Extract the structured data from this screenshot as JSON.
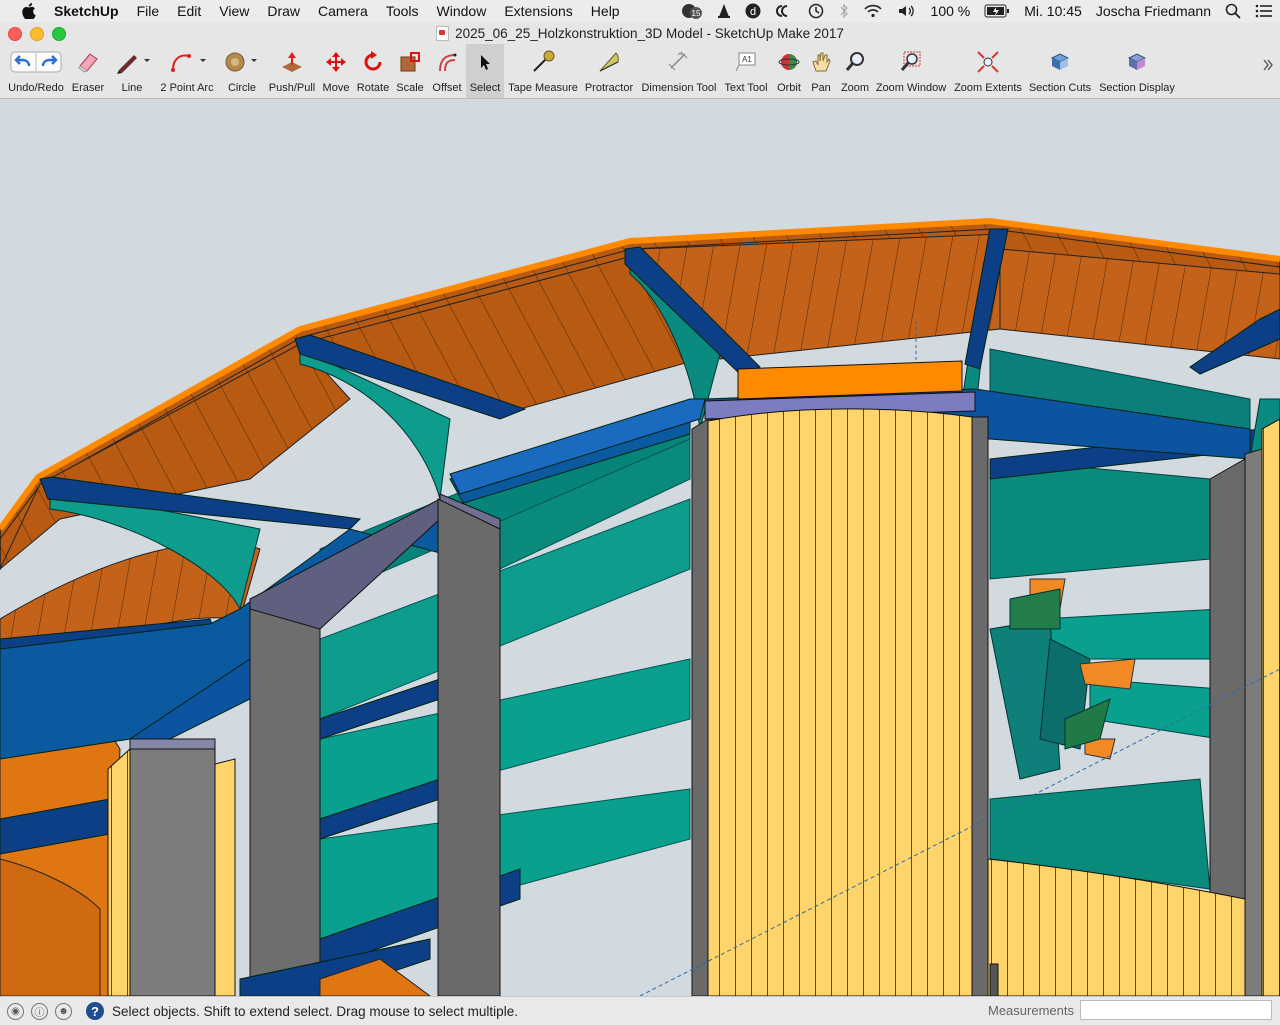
{
  "menubar": {
    "app_name": "SketchUp",
    "items": [
      "File",
      "Edit",
      "View",
      "Draw",
      "Camera",
      "Tools",
      "Window",
      "Extensions",
      "Help"
    ],
    "battery": "100 %",
    "clock": "Mi. 10:45",
    "user": "Joscha Friedmann",
    "badge_count": "15"
  },
  "window": {
    "title": "2025_06_25_Holzkonstruktion_3D Model - SketchUp Make 2017"
  },
  "toolbar": {
    "tools": [
      {
        "label": "Undo/Redo",
        "icon": "undo-redo-icon"
      },
      {
        "label": "Eraser",
        "icon": "eraser-icon"
      },
      {
        "label": "Line",
        "icon": "pencil-icon"
      },
      {
        "label": "2 Point Arc",
        "icon": "arc-icon"
      },
      {
        "label": "Circle",
        "icon": "circle-icon"
      },
      {
        "label": "Push/Pull",
        "icon": "push-pull-icon"
      },
      {
        "label": "Move",
        "icon": "move-icon"
      },
      {
        "label": "Rotate",
        "icon": "rotate-icon"
      },
      {
        "label": "Scale",
        "icon": "scale-icon"
      },
      {
        "label": "Offset",
        "icon": "offset-icon"
      },
      {
        "label": "Select",
        "icon": "select-arrow-icon"
      },
      {
        "label": "Tape Measure",
        "icon": "tape-measure-icon"
      },
      {
        "label": "Protractor",
        "icon": "protractor-icon"
      },
      {
        "label": "Dimension Tool",
        "icon": "dimension-icon"
      },
      {
        "label": "Text Tool",
        "icon": "text-tool-icon"
      },
      {
        "label": "Orbit",
        "icon": "orbit-icon"
      },
      {
        "label": "Pan",
        "icon": "pan-hand-icon"
      },
      {
        "label": "Zoom",
        "icon": "zoom-icon"
      },
      {
        "label": "Zoom Window",
        "icon": "zoom-window-icon"
      },
      {
        "label": "Zoom Extents",
        "icon": "zoom-extents-icon"
      },
      {
        "label": "Section Cuts",
        "icon": "section-cuts-icon"
      },
      {
        "label": "Section Display",
        "icon": "section-display-icon"
      }
    ],
    "active_tool": "Select",
    "text_tool_glyph": "A1"
  },
  "statusbar": {
    "message": "Select objects. Shift to extend select. Drag mouse to select multiple.",
    "measurements_label": "Measurements",
    "measurements_value": ""
  },
  "colors": {
    "roof_orange": "#c65f10",
    "beam_blue": "#0a4b8f",
    "teal": "#0e8f82",
    "column_grey": "#6c6c6c",
    "plank_yellow": "#ffd56b",
    "sky": "#d3dadf"
  }
}
